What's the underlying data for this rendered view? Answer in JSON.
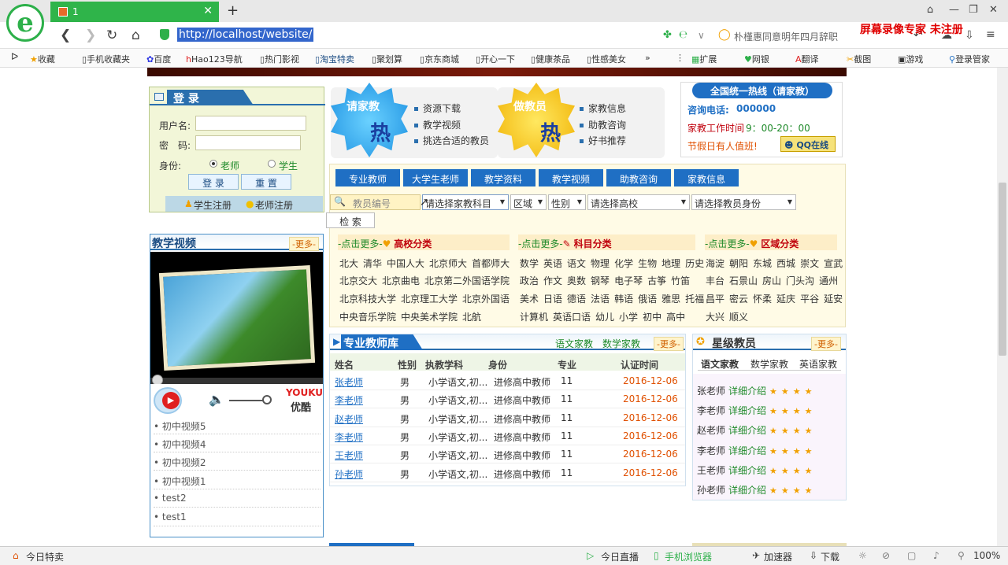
{
  "browser": {
    "tab_title": "1",
    "url": "http://localhost/website/",
    "search_hint": "朴槿惠同意明年四月辞职",
    "watermark": "屏幕录像专家 未注册",
    "bookmarks": [
      "收藏",
      "手机收藏夹",
      "百度",
      "Hao123导航",
      "热门影视",
      "淘宝特卖",
      "聚划算",
      "京东商城",
      "开心一下",
      "健康茶品",
      "性感美女"
    ],
    "bookmarks_more": "»",
    "tools": [
      "扩展",
      "网银",
      "翻译",
      "截图",
      "游戏",
      "登录管家"
    ],
    "status_left": "今日特卖",
    "status_items": [
      "今日直播",
      "手机浏览器",
      "加速器",
      "下载"
    ],
    "zoom": "100%"
  },
  "login": {
    "title": "登 录",
    "username_label": "用户名:",
    "password_label": "密　码:",
    "role_label": "身份:",
    "role_teacher": "老师",
    "role_student": "学生",
    "login_button": "登 录",
    "reset_button": "重 置",
    "student_register": "学生注册",
    "teacher_register": "老师注册"
  },
  "video": {
    "title": "教学视频",
    "more": "-更多-",
    "brand": "YOUKU",
    "brand_cn": "优酷",
    "items": [
      "初中视频5",
      "初中视频4",
      "初中视频2",
      "初中视频1",
      "test2",
      "test1"
    ]
  },
  "promo": {
    "family_star": "请家教",
    "family_hot": "热",
    "family_links": [
      "资源下载",
      "教学视频",
      "挑选合适的教员"
    ],
    "tutor_star": "做教员",
    "tutor_hot": "热",
    "tutor_links": [
      "家教信息",
      "助教咨询",
      "好书推荐"
    ]
  },
  "hotline": {
    "title": "全国统一热线（请家教）",
    "phone_label": "咨询电话:",
    "phone": "000000",
    "hours_label": "家教工作时间",
    "hours": "9：00-20：00",
    "holiday": "节假日有人值班!",
    "qq": "QQ在线"
  },
  "search": {
    "tabs": [
      "专业教师",
      "大学生老师",
      "教学资料",
      "教学视频",
      "助教咨询",
      "家教信息"
    ],
    "teacher_no_placeholder": "教员编号",
    "subject": "请选择家教科目",
    "region": "区域",
    "gender": "性别",
    "school": "请选择高校",
    "identity": "请选择教员身份",
    "search_button": "检 索"
  },
  "categories": {
    "more_label": "-点击更多-",
    "school_title": "高校分类",
    "school_rows": [
      [
        "北大",
        "清华",
        "中国人大",
        "北京师大",
        "首都师大"
      ],
      [
        "北京交大",
        "北京曲电",
        "北京第二外国语学院"
      ],
      [
        "北京科技大学",
        "北京理工大学",
        "北京外国语"
      ],
      [
        "中央音乐学院",
        "中央美术学院",
        "北航"
      ]
    ],
    "subject_title": "科目分类",
    "subject_rows": [
      [
        "数学",
        "英语",
        "语文",
        "物理",
        "化学",
        "生物",
        "地理",
        "历史"
      ],
      [
        "政治",
        "作文",
        "奥数",
        "钢琴",
        "电子琴",
        "古筝",
        "竹笛"
      ],
      [
        "美术",
        "日语",
        "德语",
        "法语",
        "韩语",
        "俄语",
        "雅思",
        "托福"
      ],
      [
        "计算机",
        "英语口语",
        "幼儿",
        "小学",
        "初中",
        "高中"
      ]
    ],
    "region_title": "区域分类",
    "region_rows": [
      [
        "海淀",
        "朝阳",
        "东城",
        "西城",
        "崇文",
        "宣武"
      ],
      [
        "丰台",
        "石景山",
        "房山",
        "门头沟",
        "通州"
      ],
      [
        "昌平",
        "密云",
        "怀柔",
        "延庆",
        "平谷",
        "延安"
      ],
      [
        "大兴",
        "顺义"
      ]
    ]
  },
  "library": {
    "title": "专业教师库",
    "tab_chinese": "语文家教",
    "tab_math": "数学家教",
    "more": "-更多-",
    "headers": [
      "姓名",
      "性别",
      "执教学科",
      "身份",
      "专业",
      "认证时间"
    ],
    "rows": [
      [
        "张老师",
        "男",
        "小学语文,初...",
        "进修高中教师",
        "11",
        "2016-12-06"
      ],
      [
        "李老师",
        "男",
        "小学语文,初...",
        "进修高中教师",
        "11",
        "2016-12-06"
      ],
      [
        "赵老师",
        "男",
        "小学语文,初...",
        "进修高中教师",
        "11",
        "2016-12-06"
      ],
      [
        "李老师",
        "男",
        "小学语文,初...",
        "进修高中教师",
        "11",
        "2016-12-06"
      ],
      [
        "王老师",
        "男",
        "小学语文,初...",
        "进修高中教师",
        "11",
        "2016-12-06"
      ],
      [
        "孙老师",
        "男",
        "小学语文,初...",
        "进修高中教师",
        "11",
        "2016-12-06"
      ]
    ]
  },
  "star_teachers": {
    "title": "星级教员",
    "more": "-更多-",
    "tabs": [
      "语文家教",
      "数学家教",
      "英语家教"
    ],
    "detail_label": "详细介绍",
    "stars": "★★★★",
    "names": [
      "张老师",
      "李老师",
      "赵老师",
      "李老师",
      "王老师",
      "孙老师"
    ]
  }
}
